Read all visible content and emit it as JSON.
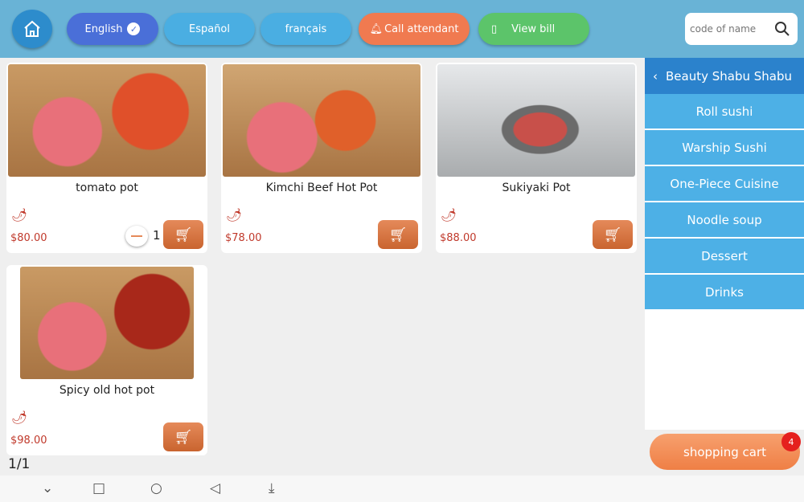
{
  "header": {
    "languages": [
      {
        "label": "English",
        "selected": true
      },
      {
        "label": "Español"
      },
      {
        "label": "français"
      }
    ],
    "call_attendant": "Call attendant",
    "view_bill": "View bill",
    "search_placeholder": "code of name"
  },
  "products": [
    {
      "name": "tomato pot",
      "price": "$80.00",
      "qty": "1"
    },
    {
      "name": "Kimchi Beef Hot Pot",
      "price": "$78.00"
    },
    {
      "name": "Sukiyaki Pot",
      "price": "$88.00"
    },
    {
      "name": "Spicy old hot pot",
      "price": "$98.00"
    }
  ],
  "sidebar": {
    "title": "Beauty Shabu Shabu",
    "items": [
      "Roll sushi",
      "Warship Sushi",
      "One-Piece Cuisine",
      "Noodle soup",
      "Dessert",
      "Drinks"
    ]
  },
  "cart": {
    "label": "shopping cart",
    "count": "4"
  },
  "pager": "1/1",
  "colors": {
    "topbar": "#69b3d6",
    "english": "#4a6fd8",
    "lang": "#4aaee2",
    "call": "#f07a50",
    "bill": "#5cc46a",
    "price": "#c0392b"
  }
}
